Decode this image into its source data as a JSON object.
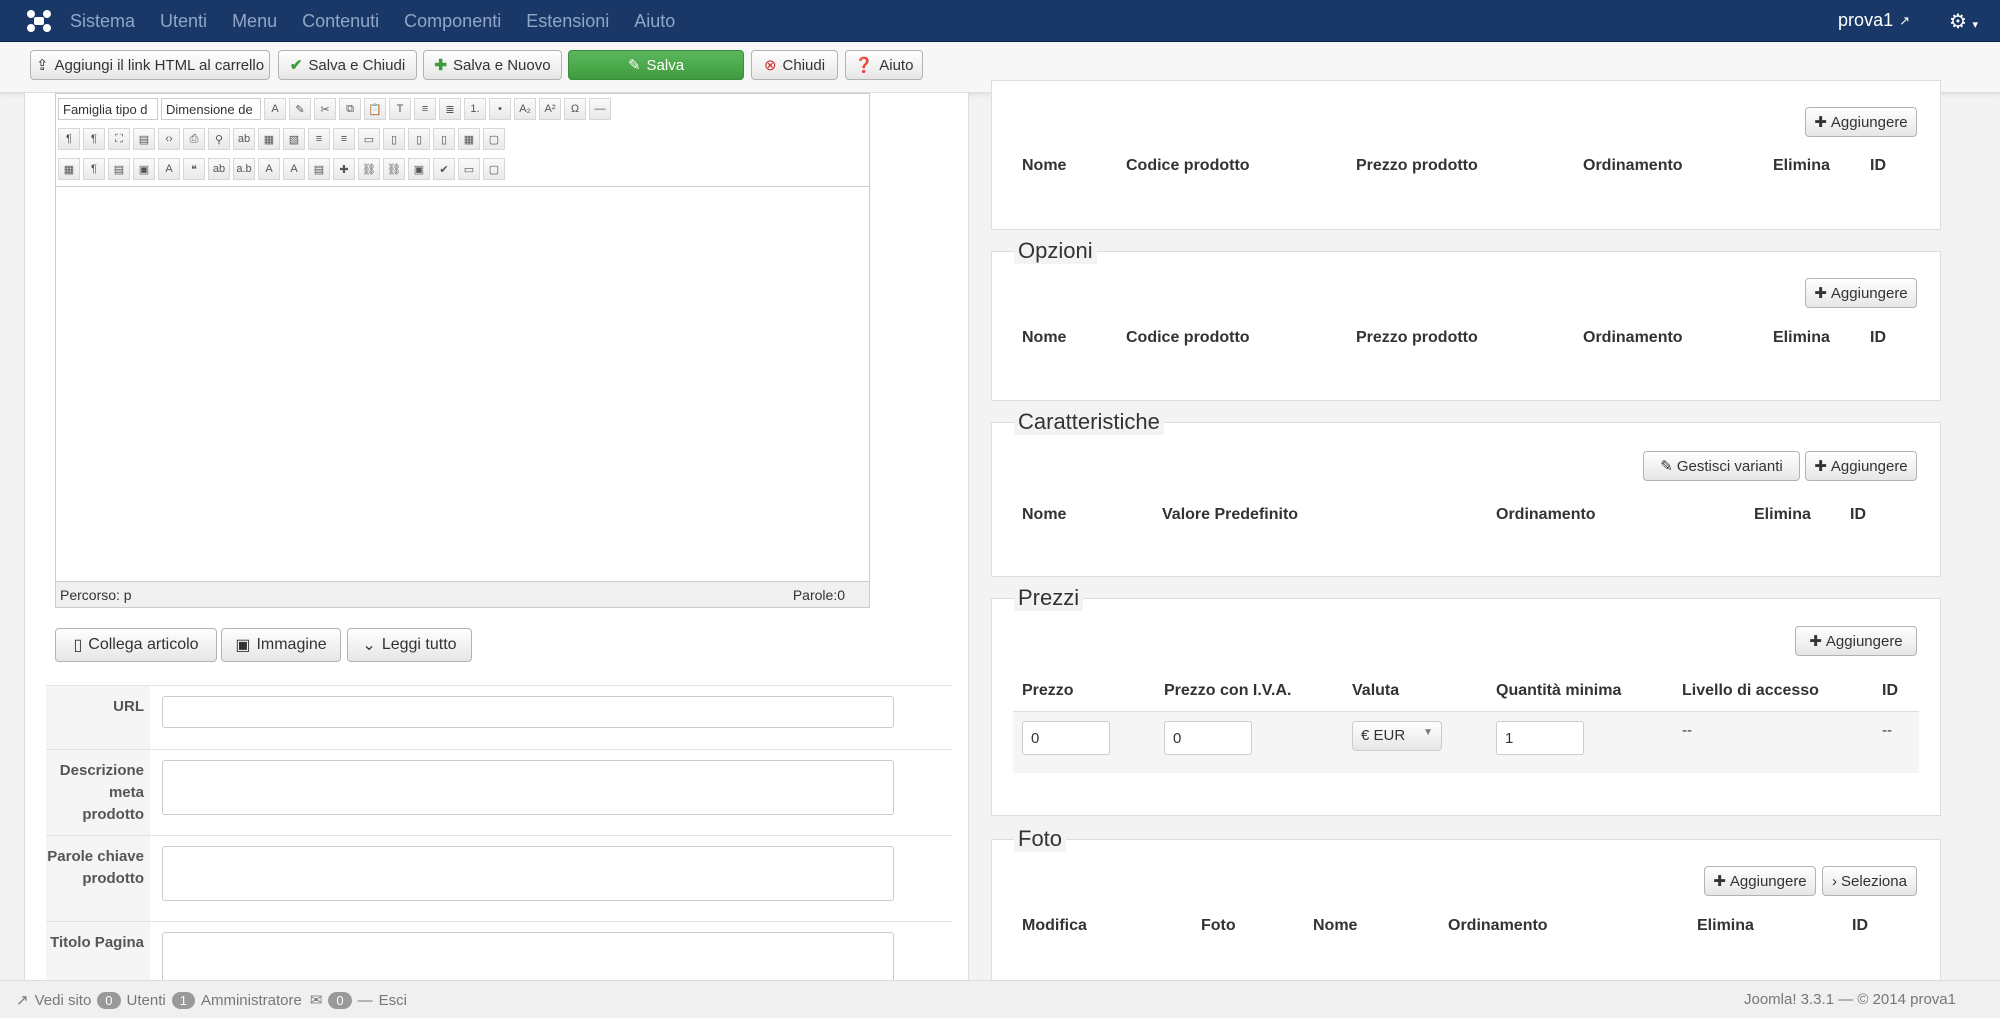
{
  "topnav": {
    "menu": [
      "Sistema",
      "Utenti",
      "Menu",
      "Contenuti",
      "Componenti",
      "Estensioni",
      "Aiuto"
    ],
    "user": "prova1"
  },
  "toolbar": {
    "add_link": "Aggiungi il link HTML al carrello",
    "save_close": "Salva e Chiudi",
    "save_new": "Salva e Nuovo",
    "save": "Salva",
    "close": "Chiudi",
    "help": "Aiuto"
  },
  "editor": {
    "font_family": "Famiglia tipo d",
    "font_size": "Dimensione de",
    "path": "Percorso: p",
    "words": "Parole:0"
  },
  "editor_buttons": {
    "link_article": "Collega articolo",
    "image": "Immagine",
    "read_more": "Leggi tutto"
  },
  "form": {
    "url_label": "URL",
    "meta_desc_label": "Descrizione meta prodotto",
    "keywords_label": "Parole chiave prodotto",
    "page_title_label": "Titolo Pagina"
  },
  "panels": {
    "related": {
      "add": "Aggiungere",
      "cols": [
        "Nome",
        "Codice prodotto",
        "Prezzo prodotto",
        "Ordinamento",
        "Elimina",
        "ID"
      ]
    },
    "options": {
      "title": "Opzioni",
      "add": "Aggiungere",
      "cols": [
        "Nome",
        "Codice prodotto",
        "Prezzo prodotto",
        "Ordinamento",
        "Elimina",
        "ID"
      ]
    },
    "characteristics": {
      "title": "Caratteristiche",
      "manage": "Gestisci varianti",
      "add": "Aggiungere",
      "cols": [
        "Nome",
        "Valore Predefinito",
        "Ordinamento",
        "Elimina",
        "ID"
      ]
    },
    "prices": {
      "title": "Prezzi",
      "add": "Aggiungere",
      "cols": [
        "Prezzo",
        "Prezzo con I.V.A.",
        "Valuta",
        "Quantità minima",
        "Livello di accesso",
        "ID"
      ],
      "row": {
        "price": "0",
        "price_vat": "0",
        "currency": "€ EUR",
        "min_qty": "1",
        "access": "--",
        "id": "--"
      }
    },
    "photos": {
      "title": "Foto",
      "add": "Aggiungere",
      "select": "Seleziona",
      "cols": [
        "Modifica",
        "Foto",
        "Nome",
        "Ordinamento",
        "Elimina",
        "ID"
      ]
    }
  },
  "footer": {
    "view_site": "Vedi sito",
    "users_count": "0",
    "users": "Utenti",
    "admins_count": "1",
    "admins": "Amministratore",
    "messages_count": "0",
    "logout": "Esci",
    "version": "Joomla! 3.3.1 — © 2014 prova1"
  }
}
